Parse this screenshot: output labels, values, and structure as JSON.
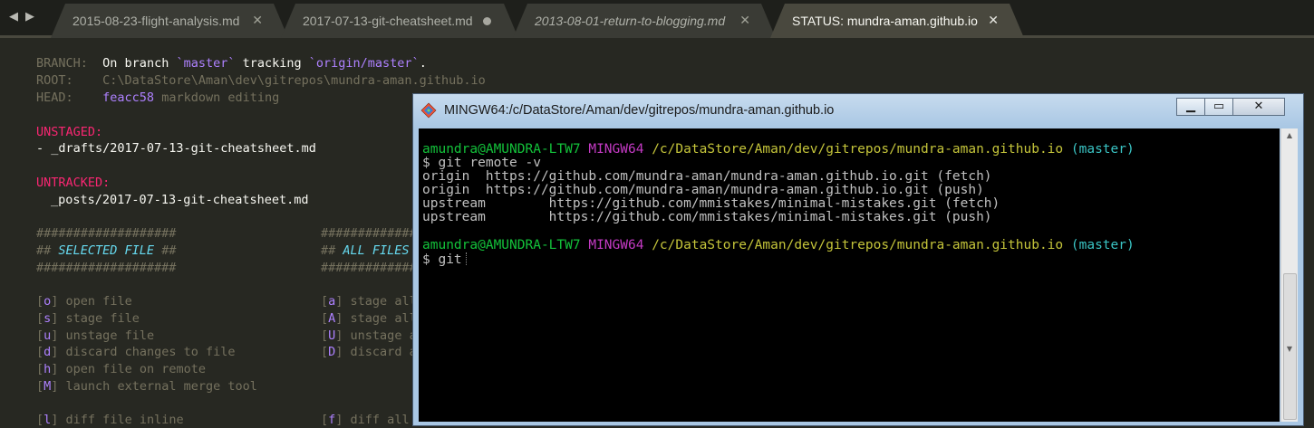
{
  "nav": {
    "back_icon": "◀",
    "forward_icon": "▶"
  },
  "tabs": [
    {
      "label": "2015-08-23-flight-analysis.md",
      "close": "✕"
    },
    {
      "label": "2017-07-13-git-cheatsheet.md",
      "state": "modified"
    },
    {
      "label": "2013-08-01-return-to-blogging.md",
      "close": "✕"
    },
    {
      "label": "STATUS: mundra-aman.github.io",
      "close": "✕"
    }
  ],
  "status": {
    "branch_label": "BRANCH:",
    "branch_pre": "On branch ",
    "branch_name": "`master`",
    "branch_mid": " tracking ",
    "branch_remote": "`origin/master`",
    "branch_end": ".",
    "root_label": "ROOT:",
    "root_value": "C:\\DataStore\\Aman\\dev\\gitrepos\\mundra-aman.github.io",
    "head_label": "HEAD:",
    "head_hash": "feacc58",
    "head_message": "markdown editing",
    "unstaged_label": "UNSTAGED:",
    "unstaged_item": "- _drafts/2017-07-13-git-cheatsheet.md",
    "untracked_label": "UNTRACKED:",
    "untracked_item": "_posts/2017-07-13-git-cheatsheet.md",
    "hash_line_left": "###################",
    "hash_line_right": "################",
    "section_left_prefix": "## ",
    "section_left_title": "SELECTED FILE",
    "section_left_suffix": " ##",
    "section_right_prefix": "## ",
    "section_right_title": "ALL FILES"
  },
  "commands_left": [
    {
      "key": "o",
      "text": "open file"
    },
    {
      "key": "s",
      "text": "stage file"
    },
    {
      "key": "u",
      "text": "unstage file"
    },
    {
      "key": "d",
      "text": "discard changes to file"
    },
    {
      "key": "h",
      "text": "open file on remote"
    },
    {
      "key": "M",
      "text": "launch external merge tool"
    },
    {
      "key": "l",
      "text": "diff file inline"
    }
  ],
  "commands_right": [
    {
      "key": "a",
      "text": "stage all"
    },
    {
      "key": "A",
      "text": "stage all"
    },
    {
      "key": "U",
      "text": "unstage a"
    },
    {
      "key": "D",
      "text": "discard a"
    },
    {
      "key": "f",
      "text": "diff all"
    }
  ],
  "terminal": {
    "title": "MINGW64:/c/DataStore/Aman/dev/gitrepos/mundra-aman.github.io",
    "minimize": "▁",
    "maximize": "▭",
    "close": "✕",
    "prompt_user": "amundra@AMUNDRA-LTW7",
    "prompt_env": "MINGW64",
    "prompt_path": "/c/DataStore/Aman/dev/gitrepos/mundra-aman.github.io",
    "prompt_branch": "(master)",
    "cmd1": "$ git remote -v",
    "output": [
      "origin  https://github.com/mundra-aman/mundra-aman.github.io.git (fetch)",
      "origin  https://github.com/mundra-aman/mundra-aman.github.io.git (push)",
      "upstream        https://github.com/mmistakes/minimal-mistakes.git (fetch)",
      "upstream        https://github.com/mmistakes/minimal-mistakes.git (push)"
    ],
    "cmd2": "$ git",
    "scroll_up": "▲",
    "scroll_down": "▼"
  }
}
